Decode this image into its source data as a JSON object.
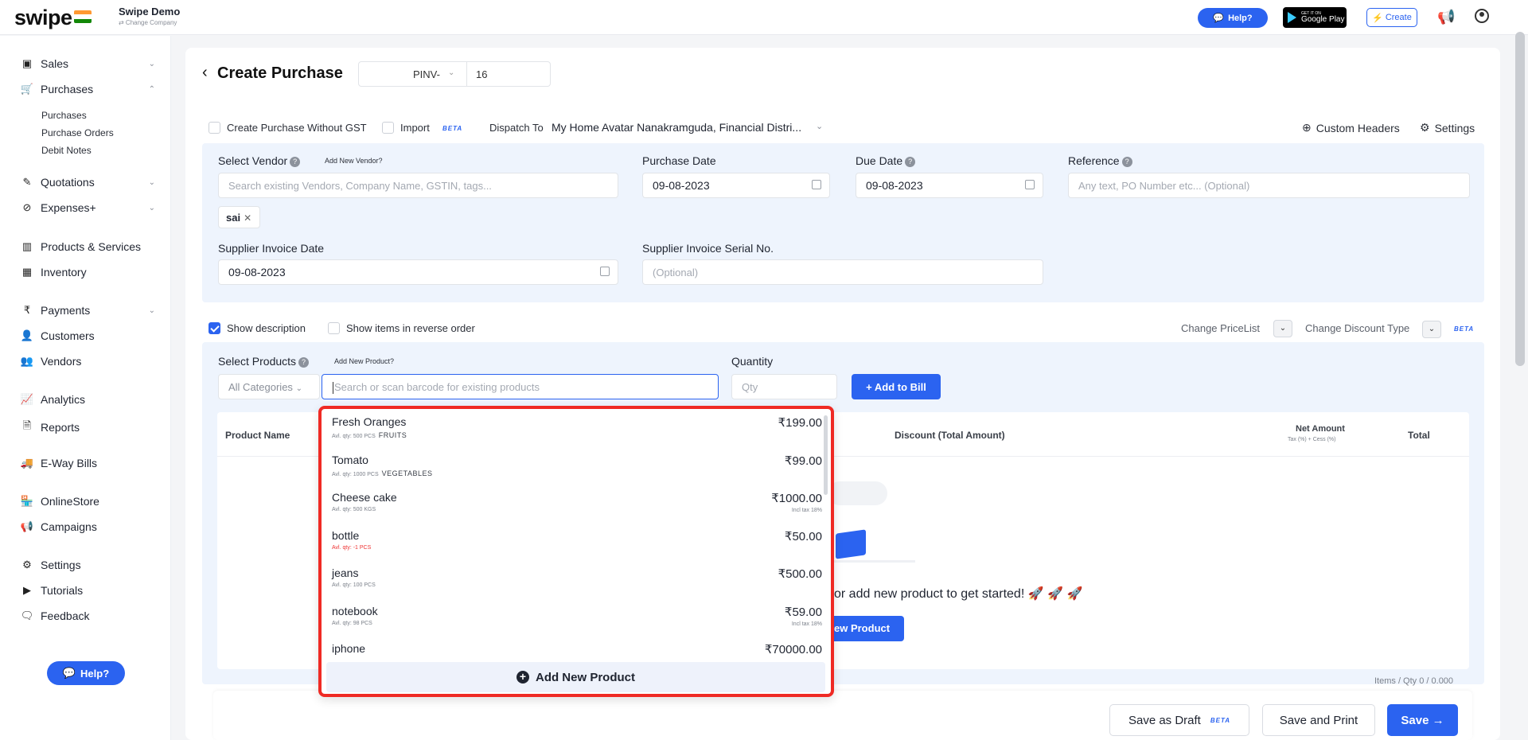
{
  "topbar": {
    "logo": "swipe",
    "company_name": "Swipe Demo",
    "company_sub": "⇄ Change Company",
    "help_label": "Help?",
    "gplay_small": "GET IT ON",
    "gplay_big": "Google Play",
    "create_label": "Create"
  },
  "sidebar": {
    "sales": "Sales",
    "purchases": "Purchases",
    "sub_purchases": "Purchases",
    "sub_purchase_orders": "Purchase Orders",
    "sub_debit_notes": "Debit Notes",
    "quotations": "Quotations",
    "expenses": "Expenses+",
    "products_services": "Products & Services",
    "inventory": "Inventory",
    "payments": "Payments",
    "customers": "Customers",
    "vendors": "Vendors",
    "analytics": "Analytics",
    "reports": "Reports",
    "eway": "E-Way Bills",
    "onlinestore": "OnlineStore",
    "campaigns": "Campaigns",
    "settings": "Settings",
    "tutorials": "Tutorials",
    "feedback": "Feedback",
    "help": "Help?"
  },
  "header": {
    "title": "Create Purchase",
    "prefix": "PINV-",
    "number": "16"
  },
  "options": {
    "without_gst": "Create Purchase Without GST",
    "import": "Import",
    "beta": "BETA",
    "dispatch_label": "Dispatch To",
    "dispatch_value": "My Home Avatar Nanakramguda, Financial Distri...",
    "custom_headers": "Custom Headers",
    "settings": "Settings"
  },
  "form": {
    "vendor_label": "Select Vendor",
    "add_vendor": "Add New Vendor?",
    "vendor_placeholder": "Search existing Vendors, Company Name, GSTIN, tags...",
    "vendor_tag": "sai",
    "purchase_date_label": "Purchase Date",
    "purchase_date": "09-08-2023",
    "due_date_label": "Due Date",
    "due_date": "09-08-2023",
    "reference_label": "Reference",
    "reference_placeholder": "Any text, PO Number etc... (Optional)",
    "supplier_inv_date_label": "Supplier Invoice Date",
    "supplier_inv_date": "09-08-2023",
    "supplier_serial_label": "Supplier Invoice Serial No.",
    "supplier_serial_placeholder": "(Optional)"
  },
  "products": {
    "show_description": "Show description",
    "reverse_order": "Show items in reverse order",
    "change_pricelist": "Change PriceList",
    "change_discount": "Change Discount Type",
    "beta": "BETA",
    "select_label": "Select Products",
    "add_new_product_link": "Add New Product?",
    "quantity_label": "Quantity",
    "categories": "All Categories",
    "search_placeholder": "Search or scan barcode for existing products",
    "qty_placeholder": "Qty",
    "add_to_bill": "+ Add to Bill",
    "col_product_name": "Product Name",
    "col_discount": "Discount (Total Amount)",
    "col_net_amount": "Net Amount",
    "col_net_sub": "Tax (%) + Cess (%)",
    "col_total": "Total",
    "empty_text": "or add new product to get started! 🚀 🚀 🚀",
    "empty_button": "ew Product",
    "items_qty": "Items / Qty 0 / 0.000"
  },
  "dropdown": {
    "items": [
      {
        "name": "Fresh Oranges",
        "meta": "Avl. qty: 500  PCS",
        "category": "FRUITS",
        "price": "₹199.00",
        "tax": ""
      },
      {
        "name": "Tomato",
        "meta": "Avl. qty: 1000  PCS",
        "category": "VEGETABLES",
        "price": "₹99.00",
        "tax": ""
      },
      {
        "name": "Cheese cake",
        "meta": "Avl. qty: 500  KGS",
        "category": "",
        "price": "₹1000.00",
        "tax": "Incl tax 18%"
      },
      {
        "name": "bottle",
        "meta": "Avl. qty: -1  PCS",
        "category": "",
        "price": "₹50.00",
        "tax": ""
      },
      {
        "name": "jeans",
        "meta": "Avl. qty: 100  PCS",
        "category": "",
        "price": "₹500.00",
        "tax": ""
      },
      {
        "name": "notebook",
        "meta": "Avl. qty: 98  PCS",
        "category": "",
        "price": "₹59.00",
        "tax": "Incl tax 18%"
      },
      {
        "name": "iphone",
        "meta": "",
        "category": "",
        "price": "₹70000.00",
        "tax": ""
      }
    ],
    "add_new": "Add New Product"
  },
  "footer": {
    "save_draft": "Save as Draft",
    "beta": "BETA",
    "save_print": "Save and Print",
    "save": "Save →"
  },
  "colors": {
    "accent": "#2b63f0",
    "highlight_border": "#ef2a24",
    "panel_bg": "#eef4fd"
  }
}
